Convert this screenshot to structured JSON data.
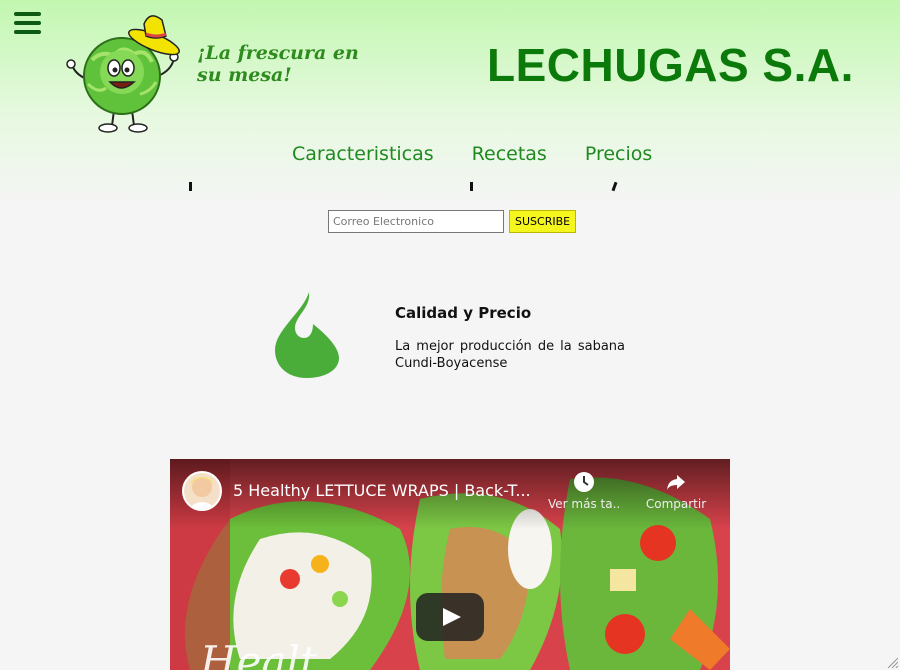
{
  "header": {
    "tagline": "¡La frescura en su mesa!",
    "brand": "LECHUGAS S.A.",
    "menu_icon": "hamburger-menu-icon",
    "mascot_icon": "lettuce-mascot-icon",
    "colors": {
      "brand": "#0b7a0b",
      "nav": "#1f8a1f",
      "header_bg": "#c2f7b0"
    }
  },
  "nav": {
    "items": [
      {
        "label": "Caracteristicas"
      },
      {
        "label": "Recetas"
      },
      {
        "label": "Precios"
      }
    ]
  },
  "subscribe": {
    "placeholder": "Correo Electronico",
    "button_label": "SUSCRIBE",
    "button_color": "#f6f61f"
  },
  "feature": {
    "icon": "flame-icon",
    "icon_color": "#4aad3a",
    "title": "Calidad y Precio",
    "text": "La mejor producción de la sabana Cundi-Boyacense"
  },
  "video": {
    "title": "5 Healthy LETTUCE WRAPS | Back-T...",
    "watch_later": "Ver más ta...",
    "share": "Compartir",
    "overlay_script": "Healt"
  }
}
